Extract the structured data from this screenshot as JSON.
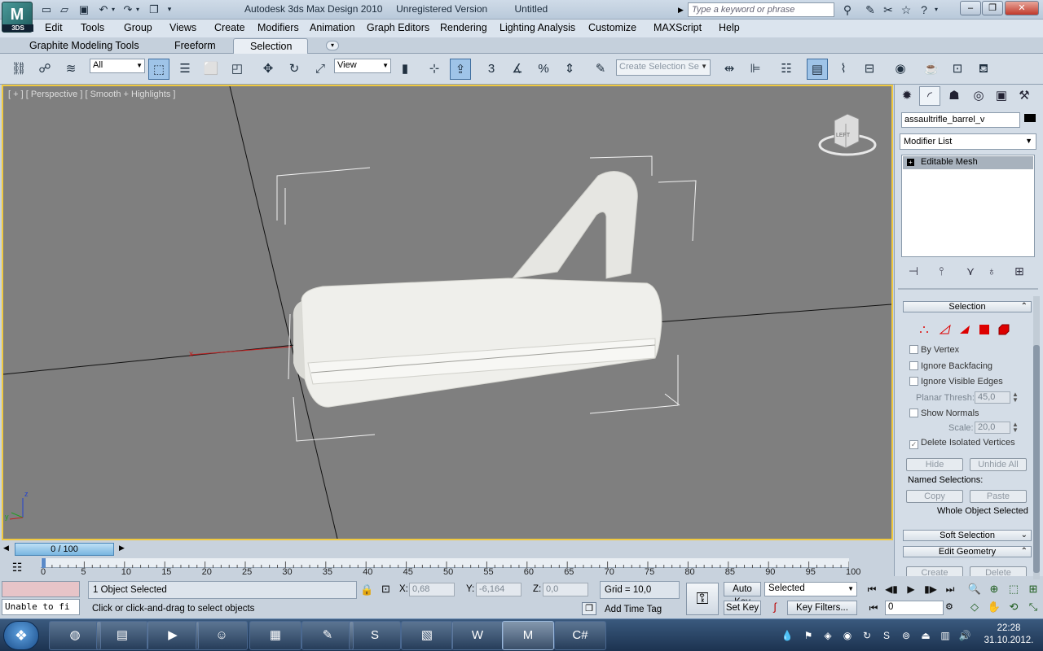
{
  "app": {
    "logo_text": "M",
    "logo_sub": "3DS",
    "window_title": "Autodesk 3ds Max Design 2010     Unregistered Version          Untitled",
    "search_placeholder": "Type a keyword or phrase"
  },
  "menu": [
    "Edit",
    "Tools",
    "Group",
    "Views",
    "Create",
    "Modifiers",
    "Animation",
    "Graph Editors",
    "Rendering",
    "Lighting Analysis",
    "Customize",
    "MAXScript",
    "Help"
  ],
  "ribbon_tabs": [
    "Graphite Modeling Tools",
    "Freeform",
    "Selection"
  ],
  "toolbar": {
    "filter_value": "All",
    "ref_coord_value": "View",
    "snap_label": "3",
    "angle_snap_label": "%",
    "selection_set_placeholder": "Create Selection Se"
  },
  "viewport": {
    "label": "[ + ] [ Perspective ] [ Smooth + Highlights ]",
    "viewcube_face": "LEFT",
    "axis_x": "x",
    "axis_y": "y",
    "axis_z": "z"
  },
  "command_panel": {
    "object_name": "assaultrifle_barrel_v",
    "modifier_list": "Modifier List",
    "stack_item": "Editable Mesh",
    "selection_rollout": "Selection",
    "by_vertex": "By Vertex",
    "ignore_backfacing": "Ignore Backfacing",
    "ignore_visible_edges": "Ignore Visible Edges",
    "planar_thresh_label": "Planar Thresh:",
    "planar_thresh_value": "45,0",
    "show_normals": "Show Normals",
    "scale_label": "Scale:",
    "scale_value": "20,0",
    "delete_isolated": "Delete Isolated Vertices",
    "hide": "Hide",
    "unhide_all": "Unhide All",
    "named_selections": "Named Selections:",
    "copy": "Copy",
    "paste": "Paste",
    "whole_object": "Whole Object Selected",
    "soft_selection": "Soft Selection",
    "edit_geometry": "Edit Geometry",
    "create": "Create",
    "delete": "Delete"
  },
  "timeline": {
    "slider_label": "0 / 100",
    "ticks": [
      "0",
      "5",
      "10",
      "15",
      "20",
      "25",
      "30",
      "35",
      "40",
      "45",
      "50",
      "55",
      "60",
      "65",
      "70",
      "75",
      "80",
      "85",
      "90",
      "95",
      "100"
    ]
  },
  "status": {
    "maxscript_output": "Unable to fi",
    "selection_count": "1 Object Selected",
    "prompt": "Click or click-and-drag to select objects",
    "x_label": "X:",
    "x_value": "0,68",
    "y_label": "Y:",
    "y_value": "-6,164",
    "z_label": "Z:",
    "z_value": "0,0",
    "grid": "Grid = 10,0",
    "add_time_tag": "Add Time Tag",
    "auto_key": "Auto Key",
    "set_key": "Set Key",
    "key_mode": "Selected",
    "key_filters": "Key Filters...",
    "frame": "0"
  },
  "taskbar": {
    "time": "22:28",
    "date": "31.10.2012."
  }
}
